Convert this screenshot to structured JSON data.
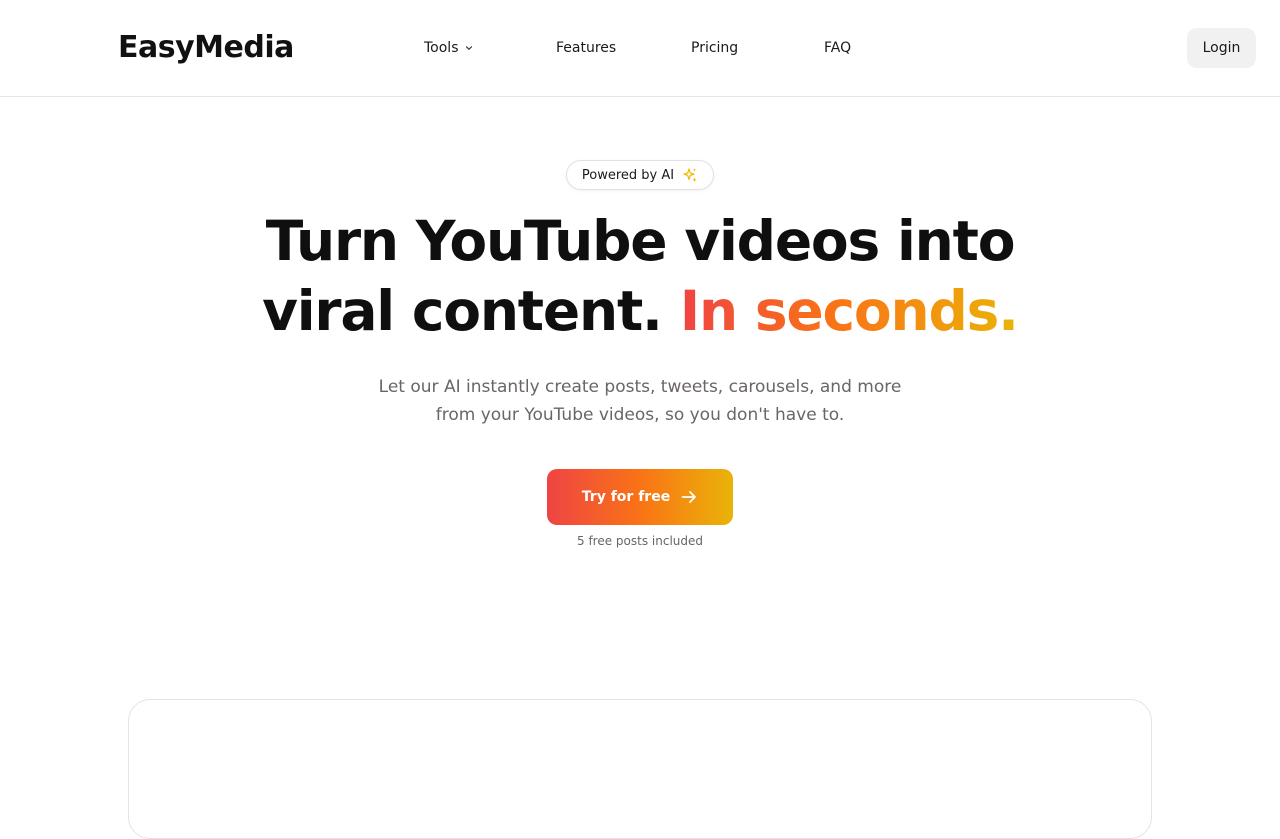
{
  "header": {
    "logo": "EasyMedia",
    "nav": {
      "tools": "Tools",
      "features": "Features",
      "pricing": "Pricing",
      "faq": "FAQ"
    },
    "login": "Login"
  },
  "hero": {
    "badge": "Powered by AI",
    "headline_line1": "Turn YouTube videos into",
    "headline_line2_plain": "viral content. ",
    "headline_line2_accent": "In seconds.",
    "sub_line1": "Let our AI instantly create posts, tweets, carousels, and more",
    "sub_line2": "from your YouTube videos, so you don't have to.",
    "cta_label": "Try for free",
    "cta_note": "5 free posts included"
  },
  "icons": {
    "tools_chevron": "chevron-down-icon",
    "badge_icon": "sparkle-icon",
    "cta_icon": "arrow-right-icon"
  },
  "colors": {
    "gradient_start": "#ef4444",
    "gradient_mid": "#f97316",
    "gradient_end": "#eab308",
    "sparkle": "#f5b400"
  }
}
